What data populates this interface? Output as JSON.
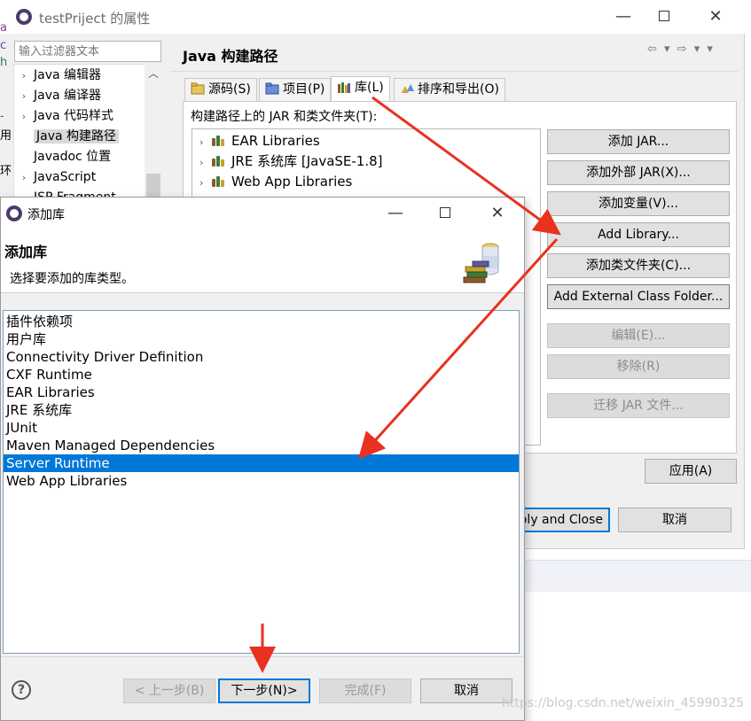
{
  "properties_window": {
    "title": "testPriject 的属性",
    "filter_placeholder": "输入过滤器文本",
    "tree_items": [
      {
        "label": "Java 编辑器",
        "chevron": "›"
      },
      {
        "label": "Java 编译器",
        "chevron": "›"
      },
      {
        "label": "Java 代码样式",
        "chevron": "›"
      },
      {
        "label": "Java 构建路径",
        "chevron": ""
      },
      {
        "label": "Javadoc 位置",
        "chevron": ""
      },
      {
        "label": "JavaScript",
        "chevron": "›"
      },
      {
        "label": "JSP Fragment",
        "chevron": ""
      }
    ],
    "page_title": "Java 构建路径",
    "nav_arrows": "⇦ ▾ ⇨ ▾ ▾",
    "tabs": [
      {
        "label": "源码(S)"
      },
      {
        "label": "项目(P)"
      },
      {
        "label": "库(L)"
      },
      {
        "label": "排序和导出(O)"
      }
    ],
    "tab_description": "构建路径上的 JAR 和类文件夹(T):",
    "jar_tree_items": [
      {
        "label": "EAR Libraries"
      },
      {
        "label": "JRE 系统库 [JavaSE-1.8]"
      },
      {
        "label": "Web App Libraries"
      }
    ],
    "side_buttons": [
      {
        "label": "添加 JAR..."
      },
      {
        "label": "添加外部 JAR(X)..."
      },
      {
        "label": "添加变量(V)..."
      },
      {
        "label": "Add Library..."
      },
      {
        "label": "添加类文件夹(C)..."
      },
      {
        "label": "Add External Class Folder..."
      },
      {
        "label": "编辑(E)..."
      },
      {
        "label": "移除(R)"
      },
      {
        "label": "迁移 JAR 文件..."
      }
    ],
    "apply_label": "应用(A)",
    "apply_close_label": "ply and Close",
    "cancel_label": "取消",
    "background_fragments": [
      "a",
      "c",
      "h",
      "-",
      "用",
      "环"
    ]
  },
  "add_library_window": {
    "title": "添加库",
    "heading": "添加库",
    "subtitle": "选择要添加的库类型。",
    "libraries": [
      "插件依赖项",
      "用户库",
      "Connectivity Driver Definition",
      "CXF Runtime",
      "EAR Libraries",
      "JRE 系统库",
      "JUnit",
      "Maven Managed Dependencies",
      "Server Runtime",
      "Web App Libraries"
    ],
    "selected_library": "Server Runtime",
    "help_glyph": "?",
    "back_label": "< 上一步(B)",
    "next_label": "下一步(N)>",
    "finish_label": "完成(F)",
    "cancel_label": "取消"
  },
  "window_controls": {
    "minimize": "—",
    "close": "✕"
  },
  "watermark": "https://blog.csdn.net/weixin_45990325",
  "colors": {
    "selection": "#0078d7",
    "annotation_arrow": "#e8311f",
    "dialog_bg": "#f0f0f0"
  }
}
